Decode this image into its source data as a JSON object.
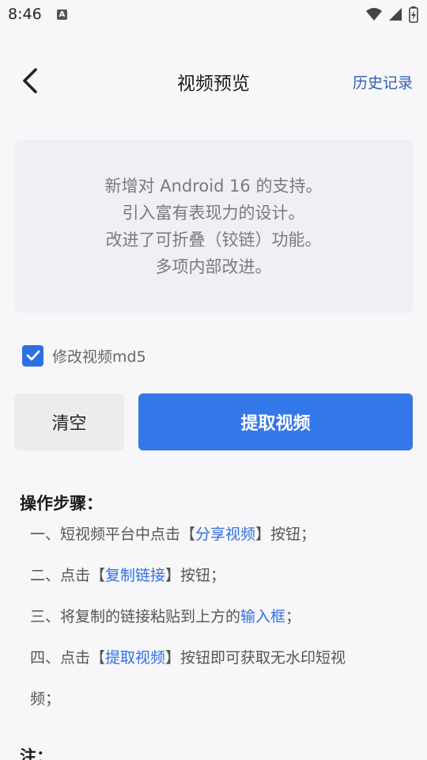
{
  "status_bar": {
    "time": "8:46",
    "a_icon_label": "A"
  },
  "header": {
    "title": "视频预览",
    "history_label": "历史记录"
  },
  "preview": {
    "lines": [
      "新增对 Android 16 的支持。",
      "引入富有表现力的设计。",
      "改进了可折叠（铰链）功能。",
      "多项内部改进。"
    ]
  },
  "options": {
    "md5_label": "修改视频md5",
    "md5_checked": true
  },
  "actions": {
    "clear_label": "清空",
    "extract_label": "提取视频"
  },
  "steps": {
    "title": "操作步骤：",
    "s1": {
      "pre": "一、短视频平台中点击【",
      "hl": "分享视频",
      "post": "】按钮；"
    },
    "s2": {
      "pre": "二、点击【",
      "hl": "复制链接",
      "post": "】按钮；"
    },
    "s3": {
      "pre": "三、将复制的链接粘贴到上方的",
      "hl": "输入框",
      "post": "；"
    },
    "s4": {
      "pre": "四、点击【",
      "hl": "提取视频",
      "post": "】按钮即可获取无水印短视",
      "cont": "频；"
    }
  },
  "note": {
    "title": "注："
  },
  "colors": {
    "accent": "#3477e8",
    "link": "#2f5fb5",
    "card_bg": "#eef0f5",
    "background": "#f7f7f9"
  }
}
